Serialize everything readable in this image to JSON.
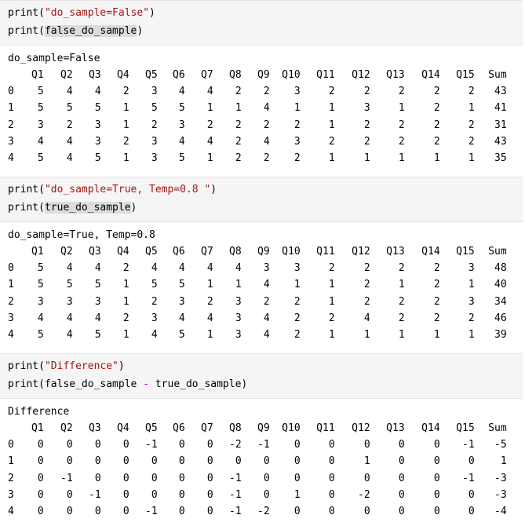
{
  "columns": [
    "",
    "Q1",
    "Q2",
    "Q3",
    "Q4",
    "Q5",
    "Q6",
    "Q7",
    "Q8",
    "Q9",
    "Q10",
    "Q11",
    "Q12",
    "Q13",
    "Q14",
    "Q15",
    "Sum"
  ],
  "cells": [
    {
      "code": [
        {
          "fn": "print(",
          "str": "\"do_sample=False\"",
          "close": ")"
        },
        {
          "fn": "print(",
          "var": "false_do_sample",
          "close": ")"
        }
      ],
      "output_title": "do_sample=False",
      "rows": [
        [
          "0",
          "5",
          "4",
          "4",
          "2",
          "3",
          "4",
          "4",
          "2",
          "2",
          "3",
          "2",
          "2",
          "2",
          "2",
          "2",
          "43"
        ],
        [
          "1",
          "5",
          "5",
          "5",
          "1",
          "5",
          "5",
          "1",
          "1",
          "4",
          "1",
          "1",
          "3",
          "1",
          "2",
          "1",
          "41"
        ],
        [
          "2",
          "3",
          "2",
          "3",
          "1",
          "2",
          "3",
          "2",
          "2",
          "2",
          "2",
          "1",
          "2",
          "2",
          "2",
          "2",
          "31"
        ],
        [
          "3",
          "4",
          "4",
          "3",
          "2",
          "3",
          "4",
          "4",
          "2",
          "4",
          "3",
          "2",
          "2",
          "2",
          "2",
          "2",
          "43"
        ],
        [
          "4",
          "5",
          "4",
          "5",
          "1",
          "3",
          "5",
          "1",
          "2",
          "2",
          "2",
          "1",
          "1",
          "1",
          "1",
          "1",
          "35"
        ]
      ]
    },
    {
      "code": [
        {
          "fn": "print(",
          "str": "\"do_sample=True, Temp=0.8 \"",
          "close": ")"
        },
        {
          "fn": "print(",
          "var": "true_do_sample",
          "close": ")"
        }
      ],
      "output_title": "do_sample=True, Temp=0.8",
      "rows": [
        [
          "0",
          "5",
          "4",
          "4",
          "2",
          "4",
          "4",
          "4",
          "4",
          "3",
          "3",
          "2",
          "2",
          "2",
          "2",
          "3",
          "48"
        ],
        [
          "1",
          "5",
          "5",
          "5",
          "1",
          "5",
          "5",
          "1",
          "1",
          "4",
          "1",
          "1",
          "2",
          "1",
          "2",
          "1",
          "40"
        ],
        [
          "2",
          "3",
          "3",
          "3",
          "1",
          "2",
          "3",
          "2",
          "3",
          "2",
          "2",
          "1",
          "2",
          "2",
          "2",
          "3",
          "34"
        ],
        [
          "3",
          "4",
          "4",
          "4",
          "2",
          "3",
          "4",
          "4",
          "3",
          "4",
          "2",
          "2",
          "4",
          "2",
          "2",
          "2",
          "46"
        ],
        [
          "4",
          "5",
          "4",
          "5",
          "1",
          "4",
          "5",
          "1",
          "3",
          "4",
          "2",
          "1",
          "1",
          "1",
          "1",
          "1",
          "39"
        ]
      ]
    },
    {
      "code": [
        {
          "fn": "print(",
          "str": "\"Difference\"",
          "close": ")"
        },
        {
          "fn": "print(false_do_sample ",
          "op": "-",
          "rest": " true_do_sample)"
        }
      ],
      "output_title": "Difference",
      "rows": [
        [
          "0",
          "0",
          "0",
          "0",
          "0",
          "-1",
          "0",
          "0",
          "-2",
          "-1",
          "0",
          "0",
          "0",
          "0",
          "0",
          "-1",
          "-5"
        ],
        [
          "1",
          "0",
          "0",
          "0",
          "0",
          "0",
          "0",
          "0",
          "0",
          "0",
          "0",
          "0",
          "1",
          "0",
          "0",
          "0",
          "1"
        ],
        [
          "2",
          "0",
          "-1",
          "0",
          "0",
          "0",
          "0",
          "0",
          "-1",
          "0",
          "0",
          "0",
          "0",
          "0",
          "0",
          "-1",
          "-3"
        ],
        [
          "3",
          "0",
          "0",
          "-1",
          "0",
          "0",
          "0",
          "0",
          "-1",
          "0",
          "1",
          "0",
          "-2",
          "0",
          "0",
          "0",
          "-3"
        ],
        [
          "4",
          "0",
          "0",
          "0",
          "0",
          "-1",
          "0",
          "0",
          "-1",
          "-2",
          "0",
          "0",
          "0",
          "0",
          "0",
          "0",
          "-4"
        ]
      ]
    }
  ]
}
